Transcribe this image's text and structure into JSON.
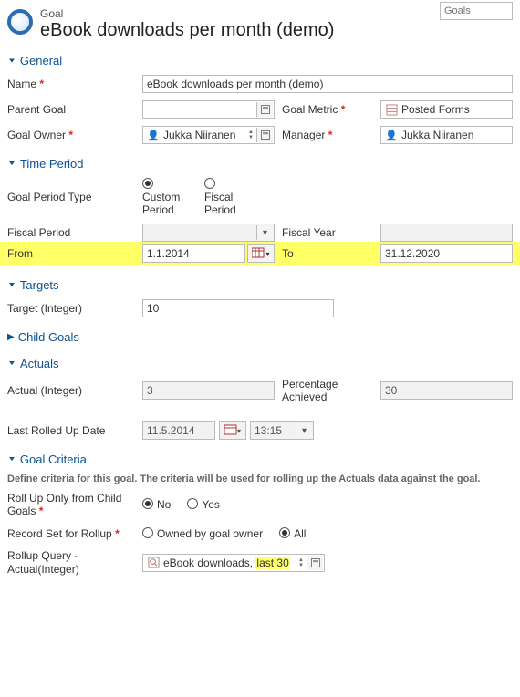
{
  "topSearch": {
    "placeholder": "Goals"
  },
  "header": {
    "entityType": "Goal",
    "title": "eBook downloads per month (demo)"
  },
  "sections": {
    "general": {
      "label": "General",
      "open": true
    },
    "timePeriod": {
      "label": "Time Period",
      "open": true
    },
    "targets": {
      "label": "Targets",
      "open": true
    },
    "childGoals": {
      "label": "Child Goals",
      "open": false
    },
    "actuals": {
      "label": "Actuals",
      "open": true
    },
    "goalCriteria": {
      "label": "Goal Criteria",
      "open": true
    }
  },
  "general": {
    "nameLabel": "Name",
    "nameValue": "eBook downloads per month (demo)",
    "parentGoalLabel": "Parent Goal",
    "parentGoalValue": "",
    "goalMetricLabel": "Goal Metric",
    "goalMetricValue": "Posted Forms",
    "goalOwnerLabel": "Goal Owner",
    "goalOwnerValue": "Jukka Niiranen",
    "managerLabel": "Manager",
    "managerValue": "Jukka Niiranen"
  },
  "timePeriod": {
    "periodTypeLabel": "Goal Period Type",
    "optCustom": "Custom Period",
    "optFiscal": "Fiscal Period",
    "fiscalPeriodLabel": "Fiscal Period",
    "fiscalPeriodValue": "",
    "fiscalYearLabel": "Fiscal Year",
    "fiscalYearValue": "",
    "fromLabel": "From",
    "fromValue": "1.1.2014",
    "toLabel": "To",
    "toValue": "31.12.2020"
  },
  "targets": {
    "targetIntLabel": "Target (Integer)",
    "targetIntValue": "10"
  },
  "actuals": {
    "actualIntLabel": "Actual (Integer)",
    "actualIntValue": "3",
    "pctLabel": "Percentage Achieved",
    "pctValue": "30",
    "lastRolledLabel": "Last Rolled Up Date",
    "lastRolledDate": "11.5.2014",
    "lastRolledTime": "13:15"
  },
  "criteria": {
    "desc": "Define criteria for this goal. The criteria will be used for rolling up the Actuals data against the goal.",
    "rollupOnlyLabel": "Roll Up Only from Child Goals",
    "optNo": "No",
    "optYes": "Yes",
    "recordSetLabel": "Record Set for Rollup",
    "optOwned": "Owned by goal owner",
    "optAll": "All",
    "rollupQueryLabel": "Rollup Query - Actual(Integer)",
    "rollupQueryPrefix": "eBook downloads, ",
    "rollupQueryHighlight": "last 30"
  }
}
